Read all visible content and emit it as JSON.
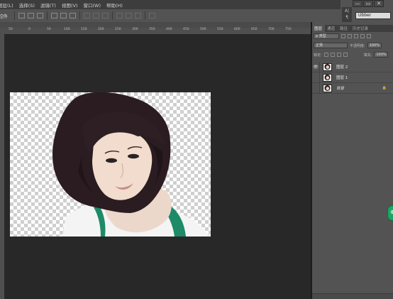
{
  "menubar": {
    "items": [
      "图层(L)",
      "选择(S)",
      "滤镜(T)",
      "视图(V)",
      "窗口(W)",
      "帮助(H)"
    ]
  },
  "options_bar": {
    "label": "控件"
  },
  "window_controls": [
    "—",
    "▭",
    "✕"
  ],
  "char_panel": {
    "font_name": "Ubber",
    "tool_icons": [
      "A|",
      "¶"
    ]
  },
  "ruler": {
    "ticks": [
      "50",
      "0",
      "50",
      "100",
      "150",
      "200",
      "250",
      "300",
      "350",
      "400",
      "450",
      "500",
      "550",
      "600",
      "650",
      "700",
      "750"
    ]
  },
  "layers_panel": {
    "tabs": [
      "图层",
      "通道",
      "路径",
      "历史记录"
    ],
    "filter_label": "ρ 类型",
    "blend_mode": "正常",
    "opacity_label": "不透明度:",
    "opacity_value": "100%",
    "lock_label": "锁定:",
    "fill_label": "填充:",
    "fill_value": "100%",
    "layers": [
      {
        "name": "图层 2",
        "visible": true,
        "locked": false
      },
      {
        "name": "图层 1",
        "visible": false,
        "locked": false
      },
      {
        "name": "背景",
        "visible": false,
        "locked": true
      }
    ]
  },
  "colors": {
    "accent_green": "#1fa463"
  }
}
